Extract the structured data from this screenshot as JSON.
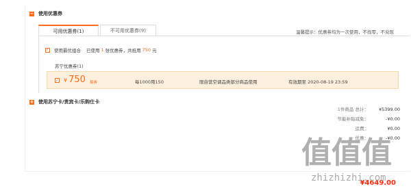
{
  "coupons_section": {
    "title": "使用优惠券",
    "collapse_symbol": "−",
    "tabs": [
      {
        "label": "可用优惠券(1)",
        "active": true
      },
      {
        "label": "不可用优惠券(9)",
        "active": false
      }
    ],
    "tip": "温馨提示：优惠券均为一次使用，不找零，不兑现",
    "best_combo": {
      "checked": true,
      "check_glyph": "✓",
      "prefix": "使用最优组合",
      "used_text_1": "已使用",
      "used_count": "1",
      "used_text_2": "张优惠券，共抵用",
      "discount": "750",
      "unit": "元"
    },
    "group_title": "苏宁优惠券(1)",
    "coupon": {
      "checked": true,
      "check_glyph": "✓",
      "currency": "¥",
      "amount": "750",
      "type": "易券",
      "rule": "每1000用150",
      "scope": "限自营空调品类部分商品使用",
      "expiry": "有效期至  2020-08-19 23:59"
    }
  },
  "cards_section": {
    "title": "使用苏宁卡/贵宾卡/乐购仕卡",
    "expand_symbol": "+"
  },
  "summary": {
    "rows": [
      {
        "label": "1件商品  总计：",
        "value": "¥5399.00"
      },
      {
        "label": "节能补贴减免：",
        "value": "-¥0.00"
      },
      {
        "label": "运费：",
        "value": "¥0.00"
      },
      {
        "label": "优惠：",
        "value": "-¥0.00"
      }
    ],
    "total": "¥4649.00"
  },
  "watermark": {
    "main": "值值值",
    "sub": "zhizhizhi.com"
  },
  "colors": {
    "accent": "#ff6a14",
    "total_red": "#ff2b10",
    "coupon_bg": "#fdf0de"
  }
}
